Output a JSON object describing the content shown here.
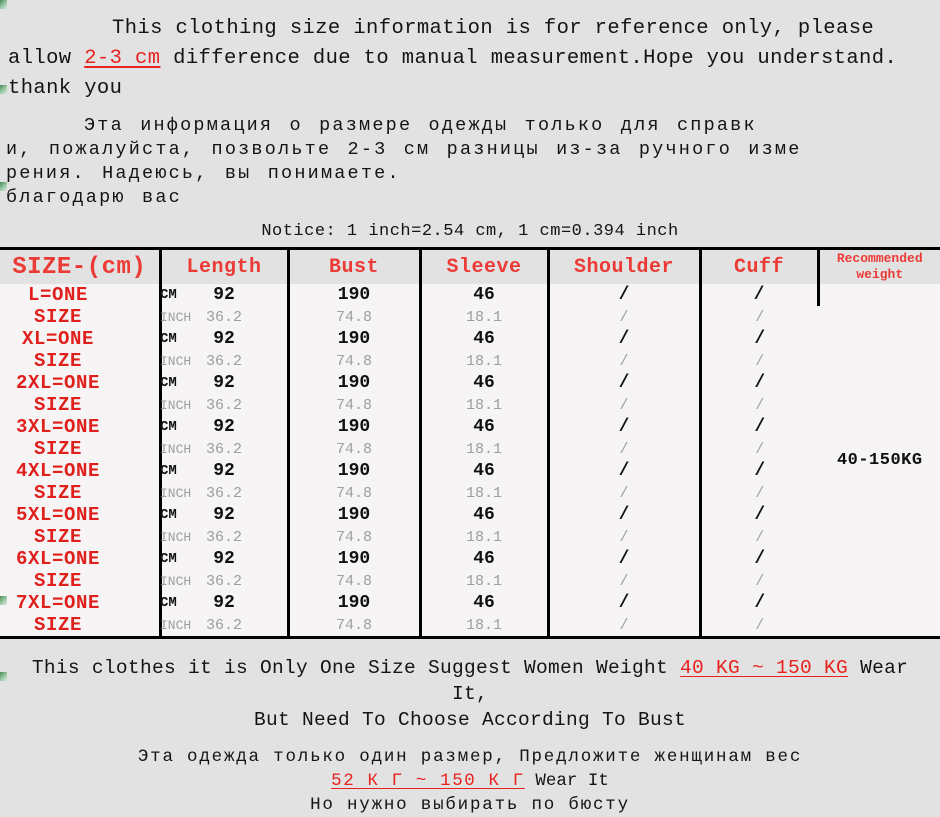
{
  "background_color": "#e2e2e2",
  "accent_color": "#e8221f",
  "header_text_color": "#ec3b36",
  "top_note": {
    "line1_pre": "This clothing size information is for reference only, please allow ",
    "line1_highlight": "2-",
    "line2_highlight": "3 cm",
    "line2_post": " difference due to manual measurement.Hope you understand. thank you"
  },
  "ru_note": {
    "line1": "Эта информация о размере одежды только для справк",
    "line2": "и, пожалуйста, позвольте 2-3 см разницы из-за ручного изме",
    "line3": "рения. Надеюсь, вы понимаете.",
    "line4": "благодарю вас"
  },
  "notice": "Notice: 1 inch=2.54 cm, 1 cm=0.394 inch",
  "table": {
    "columns": [
      "SIZE-(cm)",
      "Length",
      "Bust",
      "Sleeve",
      "Shoulder",
      "Cuff",
      "Recommended weight"
    ],
    "weight_header_line1": "Recommended",
    "weight_header_line2": "weight",
    "unit_labels": {
      "cm": "CM",
      "inch": "INCH"
    },
    "recommended_weight": "40-150KG",
    "rows": [
      {
        "size": "L=ONE SIZE",
        "cm": {
          "length": "92",
          "bust": "190",
          "sleeve": "46",
          "shoulder": "/",
          "cuff": "/"
        },
        "inch": {
          "length": "36.2",
          "bust": "74.8",
          "sleeve": "18.1",
          "shoulder": "/",
          "cuff": "/"
        }
      },
      {
        "size": "XL=ONE SIZE",
        "cm": {
          "length": "92",
          "bust": "190",
          "sleeve": "46",
          "shoulder": "/",
          "cuff": "/"
        },
        "inch": {
          "length": "36.2",
          "bust": "74.8",
          "sleeve": "18.1",
          "shoulder": "/",
          "cuff": "/"
        }
      },
      {
        "size": "2XL=ONE SIZE",
        "cm": {
          "length": "92",
          "bust": "190",
          "sleeve": "46",
          "shoulder": "/",
          "cuff": "/"
        },
        "inch": {
          "length": "36.2",
          "bust": "74.8",
          "sleeve": "18.1",
          "shoulder": "/",
          "cuff": "/"
        }
      },
      {
        "size": "3XL=ONE SIZE",
        "cm": {
          "length": "92",
          "bust": "190",
          "sleeve": "46",
          "shoulder": "/",
          "cuff": "/"
        },
        "inch": {
          "length": "36.2",
          "bust": "74.8",
          "sleeve": "18.1",
          "shoulder": "/",
          "cuff": "/"
        }
      },
      {
        "size": "4XL=ONE SIZE",
        "cm": {
          "length": "92",
          "bust": "190",
          "sleeve": "46",
          "shoulder": "/",
          "cuff": "/"
        },
        "inch": {
          "length": "36.2",
          "bust": "74.8",
          "sleeve": "18.1",
          "shoulder": "/",
          "cuff": "/"
        }
      },
      {
        "size": "5XL=ONE SIZE",
        "cm": {
          "length": "92",
          "bust": "190",
          "sleeve": "46",
          "shoulder": "/",
          "cuff": "/"
        },
        "inch": {
          "length": "36.2",
          "bust": "74.8",
          "sleeve": "18.1",
          "shoulder": "/",
          "cuff": "/"
        }
      },
      {
        "size": "6XL=ONE SIZE",
        "cm": {
          "length": "92",
          "bust": "190",
          "sleeve": "46",
          "shoulder": "/",
          "cuff": "/"
        },
        "inch": {
          "length": "36.2",
          "bust": "74.8",
          "sleeve": "18.1",
          "shoulder": "/",
          "cuff": "/"
        }
      },
      {
        "size": "7XL=ONE SIZE",
        "cm": {
          "length": "92",
          "bust": "190",
          "sleeve": "46",
          "shoulder": "/",
          "cuff": "/"
        },
        "inch": {
          "length": "36.2",
          "bust": "74.8",
          "sleeve": "18.1",
          "shoulder": "/",
          "cuff": "/"
        }
      }
    ]
  },
  "bottom_en": {
    "line1_pre": "This clothes it is Only One Size Suggest Women Weight ",
    "line1_highlight": "40 KG ~ 150 KG",
    "line1_post": " Wear It,",
    "line2": "But Need To Choose According To Bust"
  },
  "bottom_ru": {
    "line1": "Эта одежда только один размер, Предложите женщинам вес",
    "line2_highlight": "52 К Г ~ 150 К Г",
    "line2_post": " Wear It",
    "line3": "Но нужно выбирать по бюсту"
  }
}
